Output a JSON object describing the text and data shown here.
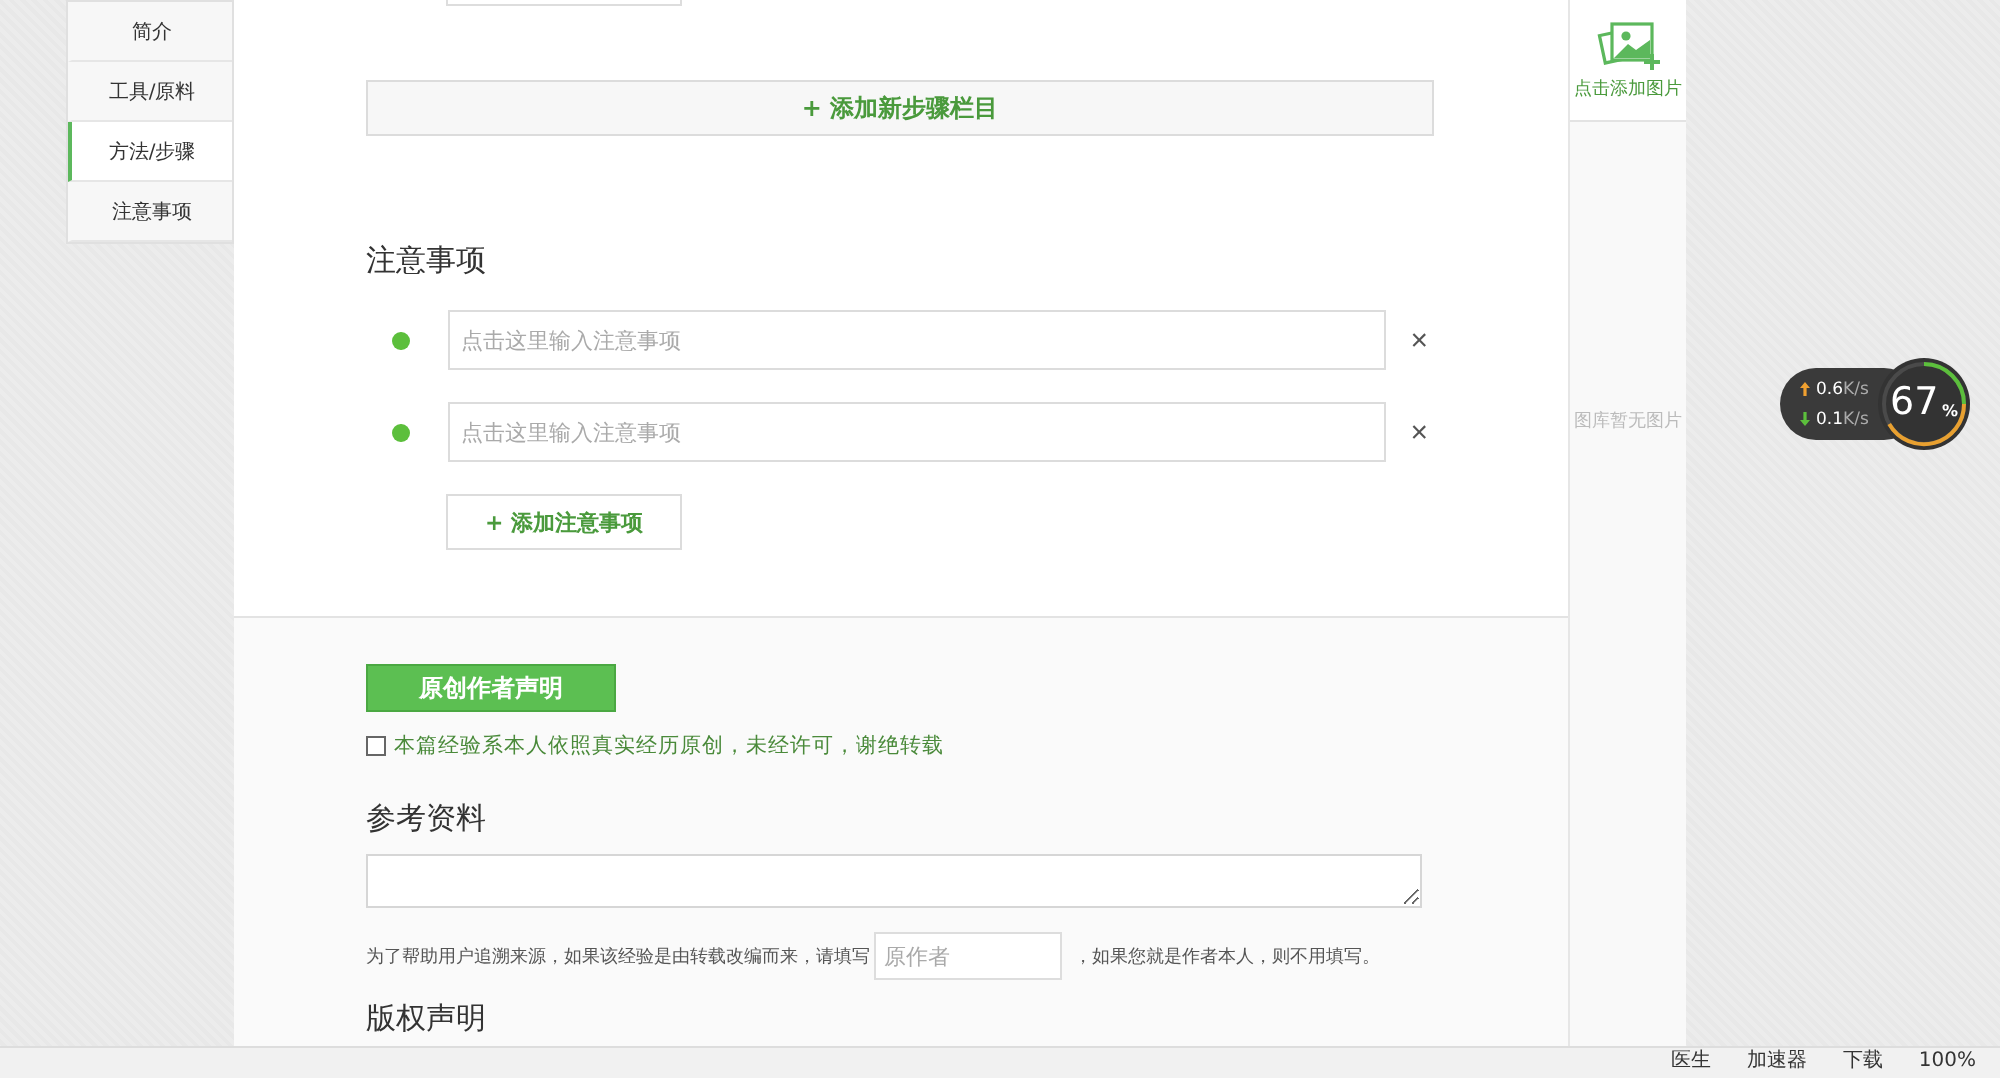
{
  "nav": {
    "items": [
      {
        "label": "简介",
        "selected": false
      },
      {
        "label": "工具/原料",
        "selected": false
      },
      {
        "label": "方法/步骤",
        "selected": true
      },
      {
        "label": "注意事项",
        "selected": false
      }
    ]
  },
  "steps": {
    "add_button": "+ 添加新步骤栏目"
  },
  "notes": {
    "title": "注意事项",
    "items": [
      {
        "placeholder": "点击这里输入注意事项",
        "remove": "×"
      },
      {
        "placeholder": "点击这里输入注意事项",
        "remove": "×"
      }
    ],
    "add_button": "+ 添加注意事项"
  },
  "original": {
    "button": "原创作者声明",
    "checkbox_label": "本篇经验系本人依照真实经历原创，未经许可，谢绝转载",
    "checked": false
  },
  "references": {
    "title": "参考资料",
    "hint_before": "为了帮助用户追溯来源，如果该经验是由转载改编而来，请填写",
    "author_placeholder": "原作者",
    "hint_after": "，如果您就是作者本人，则不用填写。"
  },
  "copyright": {
    "title": "版权声明"
  },
  "image_panel": {
    "add_label": "点击添加图片",
    "empty_text": "图库暂无图片"
  },
  "speed_widget": {
    "upload": "0.6",
    "upload_unit": "K/s",
    "download": "0.1",
    "download_unit": "K/s",
    "percent": "67",
    "percent_sign": "%"
  },
  "status_bar": {
    "items": [
      "医生",
      "加速器",
      "下载",
      "100%"
    ]
  }
}
